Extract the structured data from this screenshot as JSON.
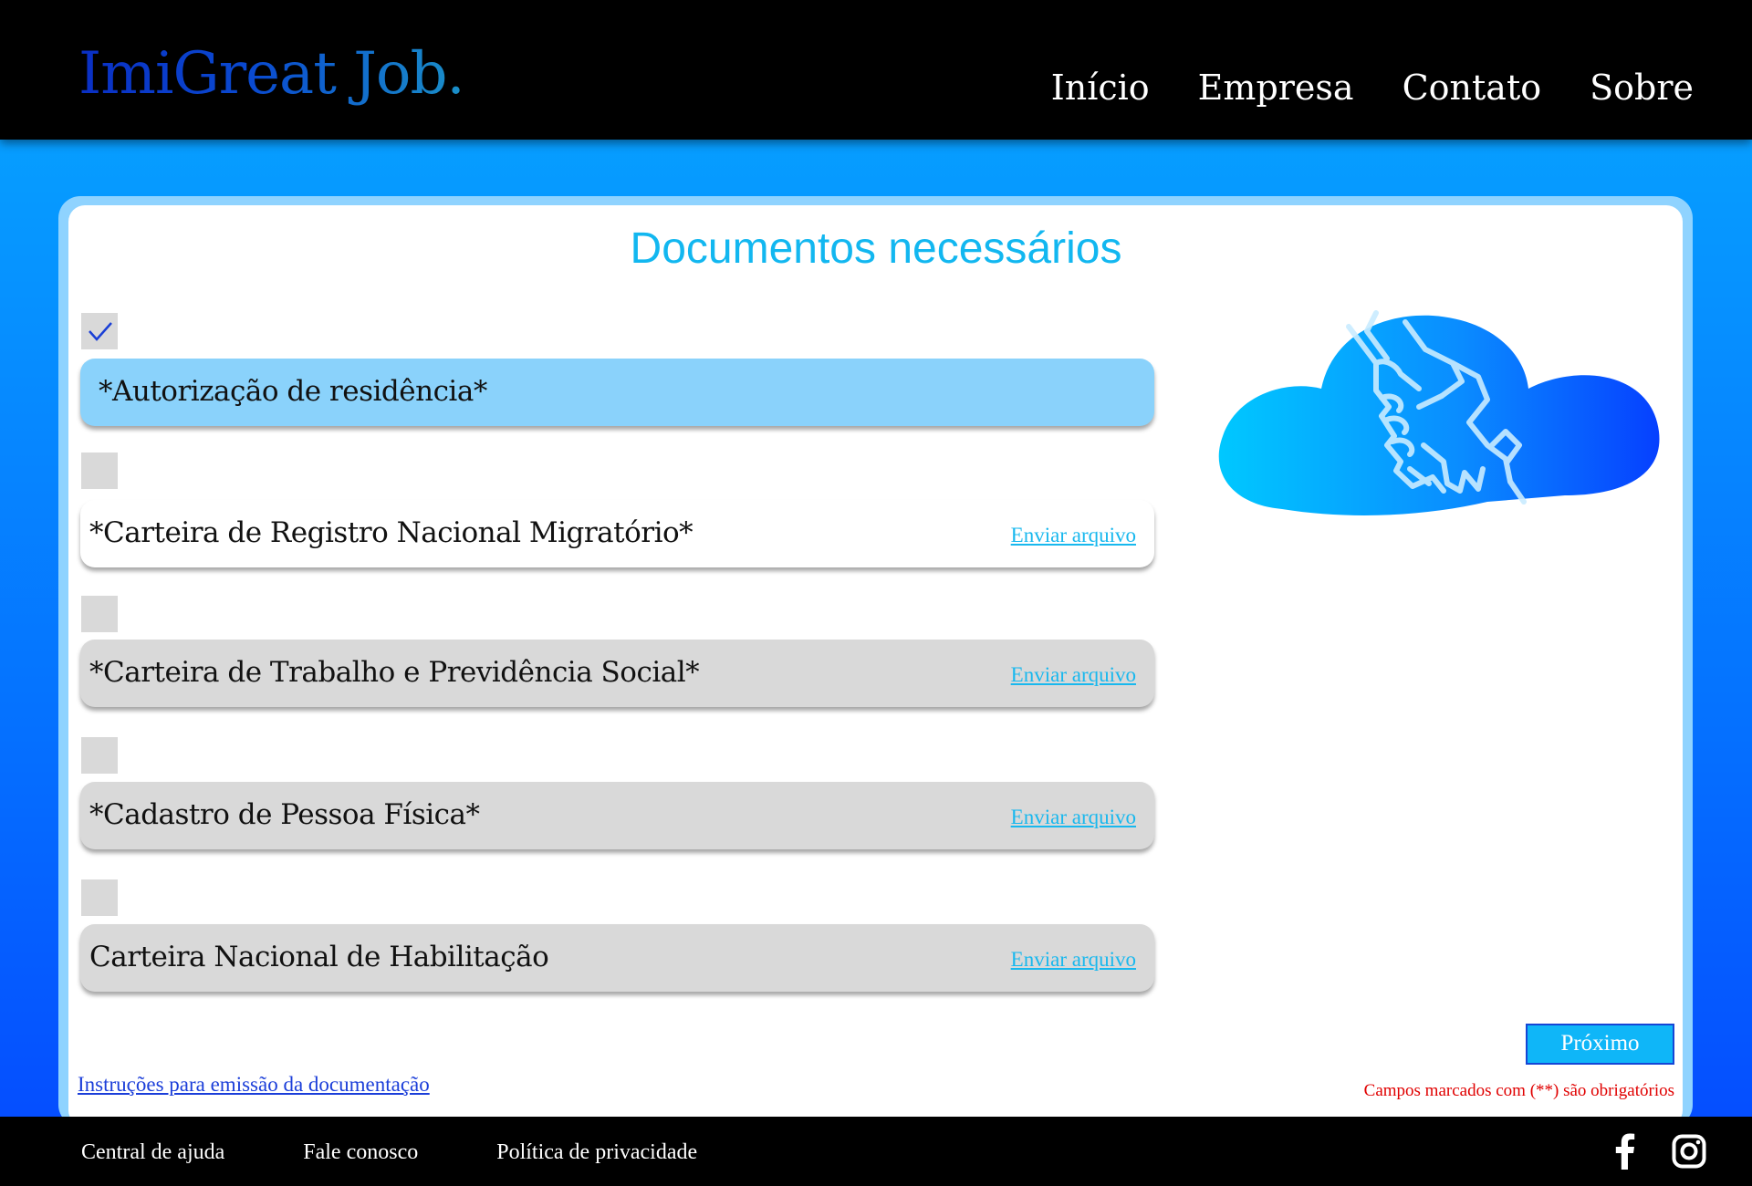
{
  "header": {
    "logo": "ImiGreat Job.",
    "nav": [
      "Início",
      "Empresa",
      "Contato",
      "Sobre"
    ]
  },
  "main": {
    "title": "Documentos necessários",
    "documents": [
      {
        "label": "*Autorização de residência*",
        "checked": true,
        "upload_label": ""
      },
      {
        "label": "*Carteira de Registro Nacional Migratório*",
        "checked": false,
        "upload_label": "Enviar arquivo"
      },
      {
        "label": "*Carteira de Trabalho e Previdência Social*",
        "checked": false,
        "upload_label": "Enviar arquivo"
      },
      {
        "label": "*Cadastro de Pessoa Física*",
        "checked": false,
        "upload_label": "Enviar arquivo"
      },
      {
        "label": "Carteira Nacional de Habilitação",
        "checked": false,
        "upload_label": "Enviar arquivo"
      }
    ],
    "next_button": "Próximo",
    "required_note": "Campos marcados com (**) são obrigatórios",
    "instructions_link": "Instruções para emissão da documentação",
    "illustration_icon": "cloud-handshake-icon"
  },
  "footer": {
    "links": [
      "Central de ajuda",
      "Fale conosco",
      "Política de privacidade"
    ],
    "social_icons": [
      "facebook-icon",
      "instagram-icon"
    ]
  },
  "colors": {
    "accent": "#12b7f0",
    "header_bg": "#000000",
    "active_row": "#8ad2fb",
    "row_bg": "#d9d9d9",
    "required": "#e00000",
    "link": "#1b3ed9"
  }
}
